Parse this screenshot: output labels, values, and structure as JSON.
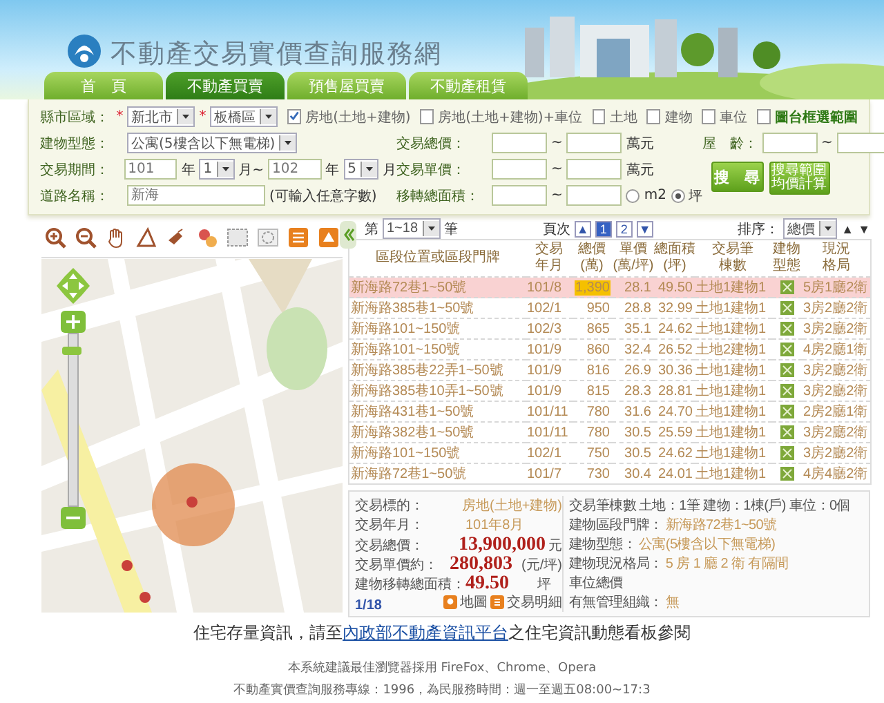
{
  "site": {
    "title": "不動產交易實價查詢服務網"
  },
  "tabs": [
    {
      "label": "首　頁",
      "selected": false
    },
    {
      "label": "不動產買賣",
      "selected": true
    },
    {
      "label": "預售屋買賣",
      "selected": false
    },
    {
      "label": "不動產租賃",
      "selected": false
    }
  ],
  "search": {
    "top_row": [
      {
        "kind": "label",
        "text": "縣市區域："
      },
      {
        "kind": "required",
        "text": "*"
      },
      {
        "kind": "select",
        "text": "新北市"
      },
      {
        "kind": "required",
        "text": "*"
      },
      {
        "kind": "select",
        "text": "板橋區"
      },
      {
        "kind": "checkbox",
        "text": "房地(土地+建物)",
        "checked": true
      },
      {
        "kind": "checkbox",
        "text": "房地(土地+建物)+車位",
        "checked": false
      },
      {
        "kind": "checkbox",
        "text": "土地",
        "checked": false
      },
      {
        "kind": "checkbox",
        "text": "建物",
        "checked": false
      },
      {
        "kind": "checkbox",
        "text": "車位",
        "checked": false
      },
      {
        "kind": "mapcheck",
        "text": "圖台框選範圍",
        "checked": false
      }
    ],
    "columns": [
      [
        [
          {
            "kind": "label",
            "text": "建物型態："
          },
          {
            "kind": "select",
            "text": "公寓(5樓含以下無電梯)"
          }
        ],
        [
          {
            "kind": "label",
            "text": "交易期間："
          },
          {
            "kind": "input",
            "text": "101"
          },
          {
            "kind": "text",
            "text": "年"
          },
          {
            "kind": "select",
            "text": "1"
          },
          {
            "kind": "text",
            "text": "月~"
          },
          {
            "kind": "input",
            "text": "102"
          },
          {
            "kind": "text",
            "text": "年"
          },
          {
            "kind": "select",
            "text": "5"
          },
          {
            "kind": "text",
            "text": "月"
          }
        ],
        [
          {
            "kind": "label",
            "text": "道路名稱："
          },
          {
            "kind": "textbox",
            "text": "新海"
          },
          {
            "kind": "text",
            "text": "(可輸入任意字數)"
          }
        ]
      ],
      [
        [
          {
            "kind": "label",
            "text": "交易總價："
          },
          {
            "kind": "input"
          },
          {
            "kind": "text",
            "text": "~"
          },
          {
            "kind": "input"
          },
          {
            "kind": "text",
            "text": "萬元"
          }
        ],
        [
          {
            "kind": "label",
            "text": "交易單價："
          },
          {
            "kind": "input"
          },
          {
            "kind": "text",
            "text": "~"
          },
          {
            "kind": "input"
          },
          {
            "kind": "text",
            "text": "萬元"
          }
        ],
        [
          {
            "kind": "label",
            "text": "移轉總面積："
          },
          {
            "kind": "input"
          },
          {
            "kind": "text",
            "text": "~"
          },
          {
            "kind": "input"
          },
          {
            "kind": "radio",
            "text": "m2",
            "selected": false
          },
          {
            "kind": "radio",
            "text": "坪",
            "selected": true
          }
        ]
      ],
      [
        [
          {
            "kind": "label",
            "text": "屋　齡："
          },
          {
            "kind": "input"
          },
          {
            "kind": "text",
            "text": "~"
          },
          {
            "kind": "input"
          }
        ],
        [
          {
            "kind": "button",
            "text": "搜　尋"
          },
          {
            "kind": "smallbutton",
            "text": "搜尋範圍均價計算"
          }
        ]
      ]
    ]
  },
  "results": {
    "range": {
      "prefix": "第",
      "value": "1~18",
      "suffix": "筆"
    },
    "pager": {
      "label": "頁次",
      "prev": "▲",
      "pages": [
        {
          "label": "1",
          "selected": true
        },
        {
          "label": "2",
          "selected": false
        }
      ],
      "next": "▼"
    },
    "sort": {
      "label": "排序：",
      "value": "總價",
      "asc": "▲",
      "desc": "▼"
    },
    "columns": [
      "區段位置或區段門牌",
      "交易年月",
      "總價(萬)",
      "單價(萬/坪)",
      "總面積(坪)",
      "交易筆棟數",
      "建物型態",
      "現況格局"
    ],
    "rows": [
      {
        "address": "新海路72巷1~50號",
        "date": "101/8",
        "total": "1,390",
        "unit": "28.1",
        "area": "49.50",
        "count": "土地1建物1",
        "layout": "5房1廳2衛",
        "selected": true
      },
      {
        "address": "新海路385巷1~50號",
        "date": "102/1",
        "total": "950",
        "unit": "28.8",
        "area": "32.99",
        "count": "土地1建物1",
        "layout": "3房2廳2衛",
        "selected": false
      },
      {
        "address": "新海路101~150號",
        "date": "102/3",
        "total": "865",
        "unit": "35.1",
        "area": "24.62",
        "count": "土地1建物1",
        "layout": "3房2廳2衛",
        "selected": false
      },
      {
        "address": "新海路101~150號",
        "date": "101/9",
        "total": "860",
        "unit": "32.4",
        "area": "26.52",
        "count": "土地2建物1",
        "layout": "4房2廳1衛",
        "selected": false
      },
      {
        "address": "新海路385巷22弄1~50號",
        "date": "101/9",
        "total": "816",
        "unit": "26.9",
        "area": "30.36",
        "count": "土地1建物1",
        "layout": "3房2廳2衛",
        "selected": false
      },
      {
        "address": "新海路385巷10弄1~50號",
        "date": "101/9",
        "total": "815",
        "unit": "28.3",
        "area": "28.81",
        "count": "土地1建物1",
        "layout": "3房2廳2衛",
        "selected": false
      },
      {
        "address": "新海路431巷1~50號",
        "date": "101/11",
        "total": "780",
        "unit": "31.6",
        "area": "24.70",
        "count": "土地1建物1",
        "layout": "2房2廳1衛",
        "selected": false
      },
      {
        "address": "新海路382巷1~50號",
        "date": "101/11",
        "total": "780",
        "unit": "30.5",
        "area": "25.59",
        "count": "土地1建物1",
        "layout": "3房2廳2衛",
        "selected": false
      },
      {
        "address": "新海路101~150號",
        "date": "102/1",
        "total": "750",
        "unit": "30.5",
        "area": "24.62",
        "count": "土地1建物1",
        "layout": "3房2廳2衛",
        "selected": false
      },
      {
        "address": "新海路72巷1~50號",
        "date": "101/7",
        "total": "730",
        "unit": "30.4",
        "area": "24.01",
        "count": "土地1建物1",
        "layout": "4房4廳2衛",
        "selected": false
      }
    ]
  },
  "detail": {
    "left": [
      {
        "kind": "plain",
        "label": "交易標的：",
        "value": "房地(土地+建物)"
      },
      {
        "kind": "plain",
        "label": "交易年月：",
        "value": "101年8月"
      },
      {
        "kind": "big",
        "label": "交易總價：",
        "value": "13,900,000",
        "unit": "元"
      },
      {
        "kind": "big",
        "label": "交易單價約：",
        "value": "280,803",
        "unit": "(元/坪)"
      },
      {
        "kind": "big",
        "label": "建物移轉總面積：",
        "value": "49.50",
        "unit": "坪"
      }
    ],
    "right": [
      {
        "kind": "dark",
        "label": "交易筆棟數",
        "value": "土地：1筆 建物：1棟(戶) 車位：0個"
      },
      {
        "kind": "plain",
        "label": "建物區段門牌：",
        "value": "新海路72巷1~50號"
      },
      {
        "kind": "plain",
        "label": "建物型態：",
        "value": "公寓(5樓含以下無電梯)"
      },
      {
        "kind": "plain",
        "label": "建物現況格局：",
        "value": "5 房 1 廳 2 衛 有隔間"
      },
      {
        "kind": "plain",
        "label": "車位總價"
      },
      {
        "kind": "plain",
        "label": "有無管理組織：",
        "value": "無"
      }
    ],
    "counter": "1/18",
    "map_button": "地圖",
    "detail_button": "交易明細"
  },
  "map": {
    "zoom": {
      "level": 0.9
    }
  },
  "footer": {
    "notice_before": "住宅存量資訊，請至",
    "notice_link": "內政部不動產資訊平台",
    "notice_after": "之住宅資訊動態看板參閱",
    "browser_note": "本系統建議最佳瀏覽器採用 FireFox、Chrome、Opera",
    "service_note": "不動產實價查詢服務專線：1996，為民服務時間：週一至週五08:00~17:3"
  }
}
